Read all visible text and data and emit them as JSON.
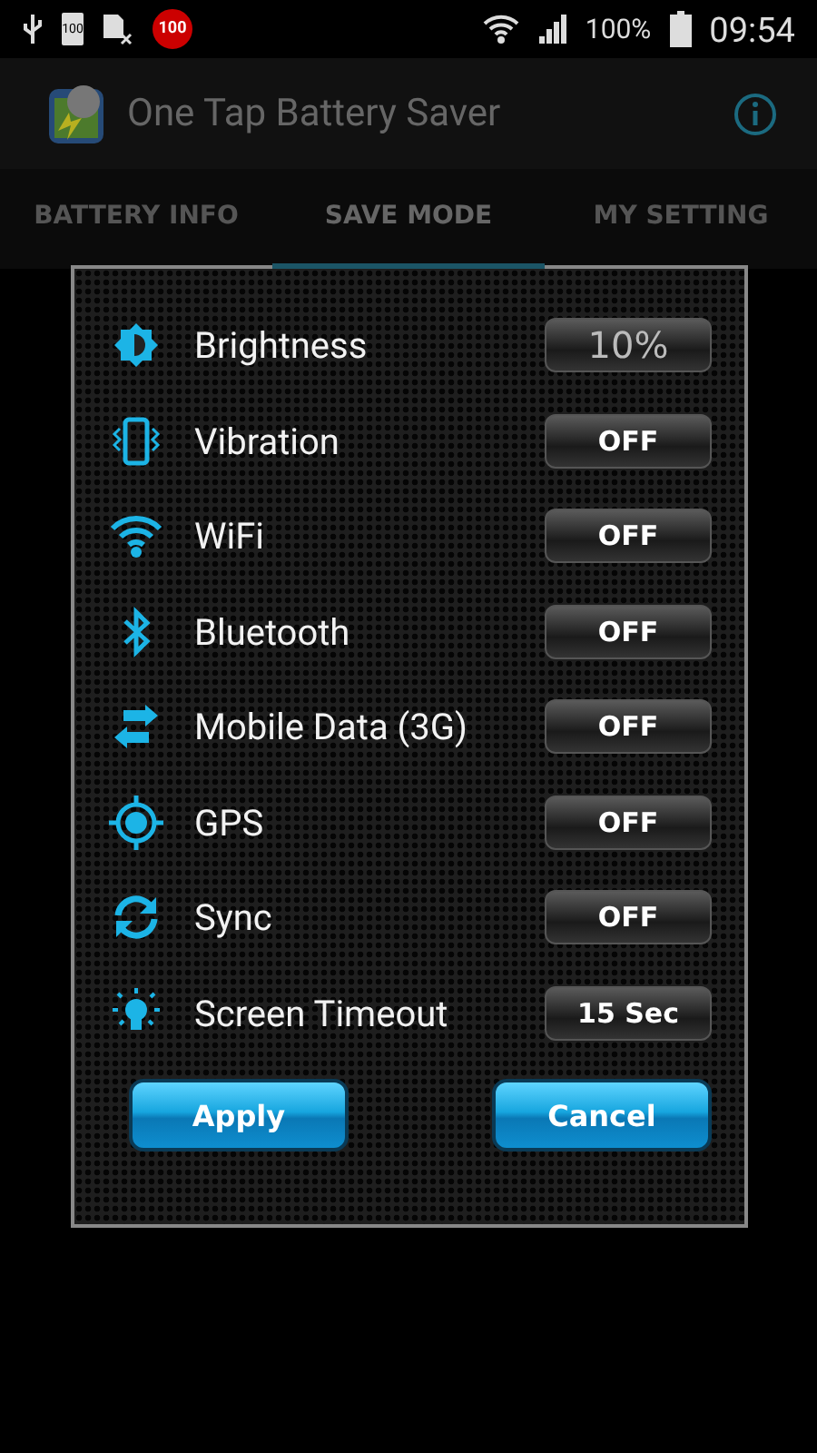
{
  "status_bar": {
    "notif_badge_1": "100",
    "notif_badge_2": "100",
    "battery_percent": "100%",
    "time": "09:54"
  },
  "app_bar": {
    "title": "One Tap Battery Saver"
  },
  "tabs": [
    {
      "label": "BATTERY INFO",
      "selected": false
    },
    {
      "label": "SAVE MODE",
      "selected": true
    },
    {
      "label": "MY SETTING",
      "selected": false
    }
  ],
  "dialog": {
    "settings": [
      {
        "label": "Brightness",
        "value": "10%",
        "kind": "percent"
      },
      {
        "label": "Vibration",
        "value": "OFF",
        "kind": "switch"
      },
      {
        "label": "WiFi",
        "value": "OFF",
        "kind": "switch"
      },
      {
        "label": "Bluetooth",
        "value": "OFF",
        "kind": "switch"
      },
      {
        "label": "Mobile Data (3G)",
        "value": "OFF",
        "kind": "switch"
      },
      {
        "label": "GPS",
        "value": "OFF",
        "kind": "switch"
      },
      {
        "label": "Sync",
        "value": "OFF",
        "kind": "switch"
      },
      {
        "label": "Screen Timeout",
        "value": "15 Sec",
        "kind": "switch"
      }
    ],
    "buttons": [
      "Apply",
      "Cancel"
    ]
  }
}
